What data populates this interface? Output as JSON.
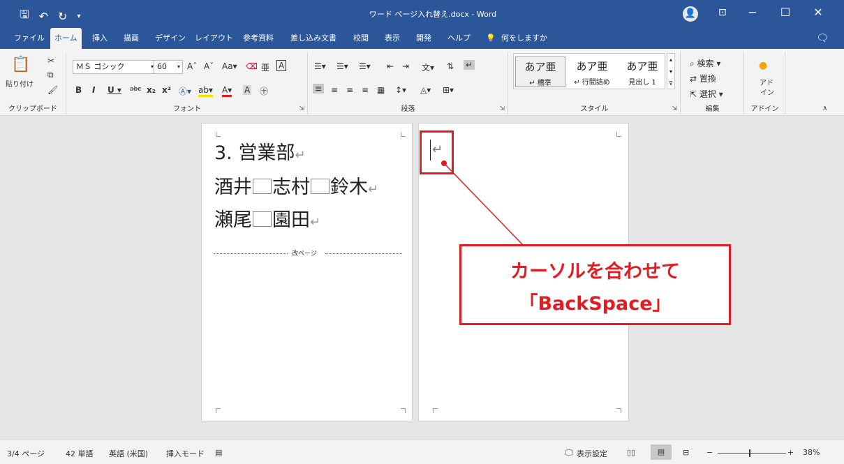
{
  "titlebar": {
    "title": "ワード ページ入れ替え.docx  -  Word",
    "qa_icons": [
      "save-icon",
      "undo-icon",
      "redo-icon",
      "customize-icon"
    ],
    "avatar_icon": "person-icon",
    "win_min": "−",
    "win_max": "☐",
    "win_close": "✕"
  },
  "tabs": [
    "ファイル",
    "ホーム",
    "挿入",
    "描画",
    "デザイン",
    "レイアウト",
    "参考資料",
    "差し込み文書",
    "校閲",
    "表示",
    "開発",
    "ヘルプ",
    "何をしますか"
  ],
  "active_tab": "ホーム",
  "ribbon": {
    "clipboard": {
      "paste_label": "貼り付け",
      "group_label": "クリップボード"
    },
    "font": {
      "font_name": "ＭＳ ゴシック",
      "font_size": "60",
      "group_label": "フォント"
    },
    "paragraph": {
      "group_label": "段落"
    },
    "styles": {
      "group_label": "スタイル",
      "items": [
        {
          "sample": "あア亜",
          "name": "↵ 標準"
        },
        {
          "sample": "あア亜",
          "name": "↵ 行間詰め"
        },
        {
          "sample": "あア亜",
          "name": "見出し 1"
        }
      ]
    },
    "editing": {
      "find": "検索",
      "replace": "置換",
      "select": "選択",
      "group_label": "編集"
    },
    "addin": {
      "label1": "アド",
      "label2": "イン",
      "group_label": "アドイン"
    }
  },
  "document": {
    "page1_lines": [
      {
        "parts": [
          "3. 営業部"
        ]
      },
      {
        "parts": [
          "酒井",
          "志村",
          "鈴木"
        ]
      },
      {
        "parts": [
          "瀬尾",
          "園田"
        ]
      }
    ],
    "return_mark": "↵",
    "page_break_label": "改ページ"
  },
  "callout": {
    "line1": "カーソルを合わせて",
    "line2": "「BackSpace」",
    "color": "#e21c23"
  },
  "status": {
    "page": "3/4 ページ",
    "words": "42 単語",
    "language": "英語 (米国)",
    "mode": "挿入モード",
    "display_settings": "表示設定",
    "zoom": "38%"
  }
}
